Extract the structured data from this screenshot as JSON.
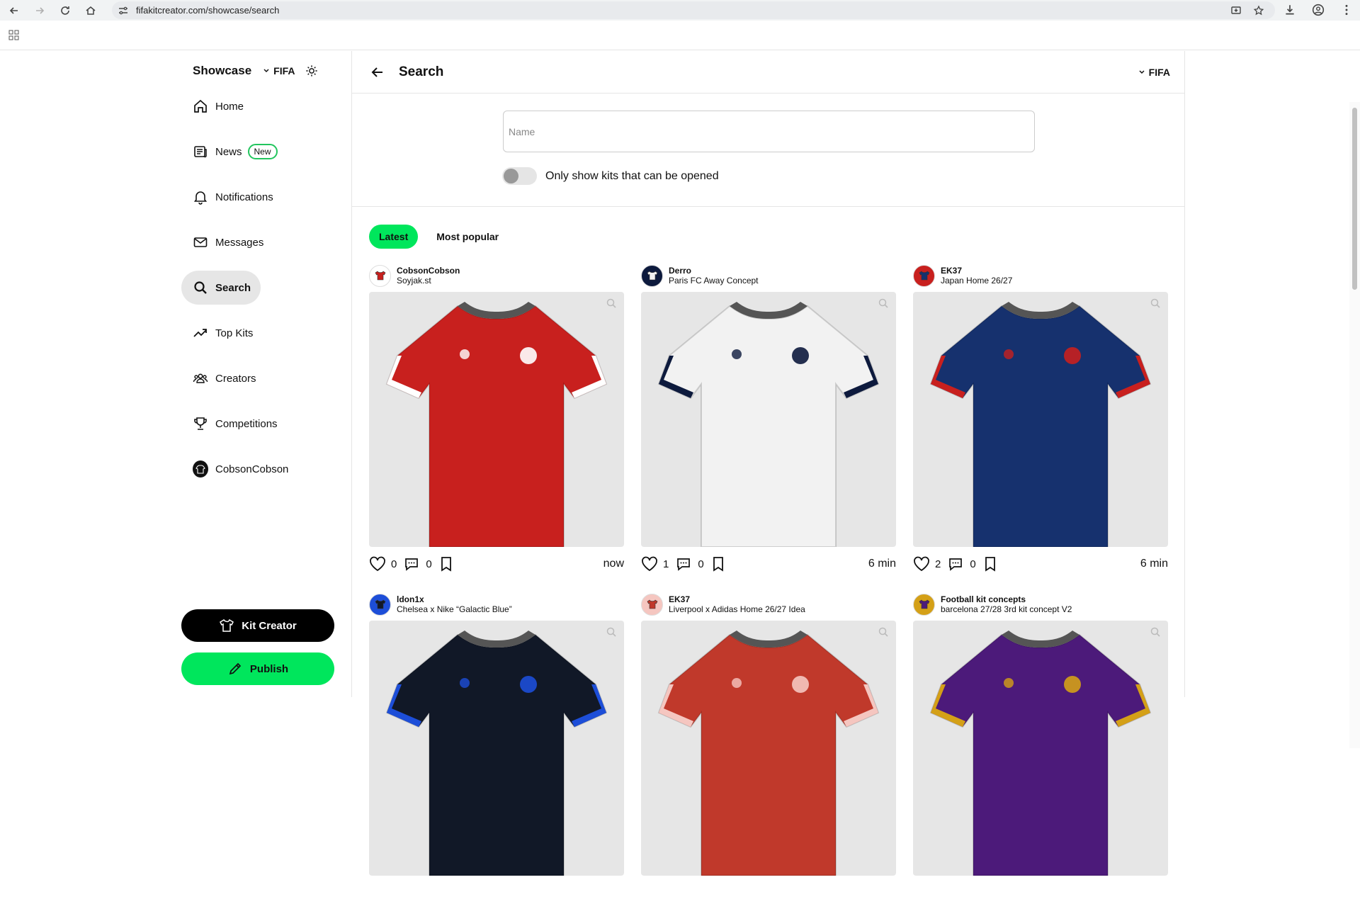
{
  "browser": {
    "url": "fifakitcreator.com/showcase/search"
  },
  "sidebar": {
    "brand": "Showcase",
    "game": "FIFA",
    "items": [
      {
        "label": "Home",
        "icon": "home-icon"
      },
      {
        "label": "News",
        "icon": "news-icon",
        "badge": "New"
      },
      {
        "label": "Notifications",
        "icon": "bell-icon"
      },
      {
        "label": "Messages",
        "icon": "mail-icon"
      },
      {
        "label": "Search",
        "icon": "search-icon",
        "active": true
      },
      {
        "label": "Top Kits",
        "icon": "trending-icon"
      },
      {
        "label": "Creators",
        "icon": "users-icon"
      },
      {
        "label": "Competitions",
        "icon": "trophy-icon"
      },
      {
        "label": "CobsonCobson",
        "icon": "avatar"
      }
    ],
    "kit_creator_label": "Kit Creator",
    "publish_label": "Publish"
  },
  "header": {
    "title": "Search",
    "game": "FIFA"
  },
  "search": {
    "placeholder": "Name",
    "value": "",
    "toggle_label": "Only show kits that can be opened",
    "toggle_on": false
  },
  "tabs": [
    {
      "label": "Latest",
      "active": true
    },
    {
      "label": "Most popular",
      "active": false
    }
  ],
  "cards": [
    {
      "user": "CobsonCobson",
      "kit": "Soyjak.st",
      "likes": "0",
      "comments": "0",
      "time": "now",
      "shirt_color": "#c8201e",
      "accent": "#ffffff"
    },
    {
      "user": "Derro",
      "kit": "Paris FC Away Concept",
      "likes": "1",
      "comments": "0",
      "time": "6 min",
      "shirt_color": "#f2f2f2",
      "accent": "#0d1a3d"
    },
    {
      "user": "EK37",
      "kit": "Japan Home 26/27",
      "likes": "2",
      "comments": "0",
      "time": "6 min",
      "shirt_color": "#16316e",
      "accent": "#c8201e"
    },
    {
      "user": "ldon1x",
      "kit": "Chelsea x Nike “Galactic Blue”",
      "shirt_color": "#111827",
      "accent": "#1d4ed8"
    },
    {
      "user": "EK37",
      "kit": "Liverpool x Adidas Home 26/27 Idea",
      "shirt_color": "#c0392b",
      "accent": "#f5c6c0"
    },
    {
      "user": "Football kit concepts",
      "kit": "barcelona 27/28 3rd kit concept V2",
      "shirt_color": "#4c1a7a",
      "accent": "#d4a017"
    }
  ]
}
